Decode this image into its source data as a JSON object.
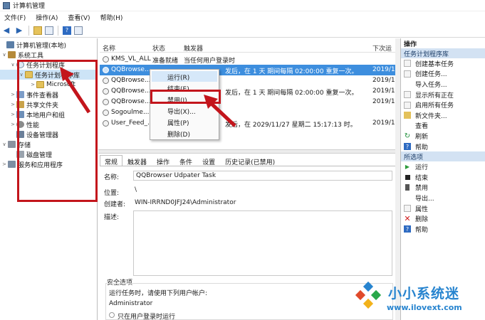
{
  "window": {
    "title": "计算机管理"
  },
  "menu": [
    "文件(F)",
    "操作(A)",
    "查看(V)",
    "帮助(H)"
  ],
  "toolbar": {
    "help_glyph": "?"
  },
  "tree": {
    "items": [
      {
        "label": "计算机管理(本地)",
        "arrow": ""
      },
      {
        "label": "系统工具",
        "arrow": "∨"
      },
      {
        "label": "任务计划程序",
        "arrow": "∨"
      },
      {
        "label": "任务计划程序库",
        "arrow": "∨"
      },
      {
        "label": "Microsoft",
        "arrow": ">"
      },
      {
        "label": "事件查看器",
        "arrow": ">"
      },
      {
        "label": "共享文件夹",
        "arrow": ">"
      },
      {
        "label": "本地用户和组",
        "arrow": ">"
      },
      {
        "label": "性能",
        "arrow": ">"
      },
      {
        "label": "设备管理器",
        "arrow": ""
      },
      {
        "label": "存储",
        "arrow": "∨"
      },
      {
        "label": "磁盘管理",
        "arrow": ""
      },
      {
        "label": "服务和应用程序",
        "arrow": ">"
      }
    ]
  },
  "list": {
    "headers": {
      "name": "名称",
      "status": "状态",
      "trigger": "触发器",
      "next": "下次运"
    },
    "rows": [
      {
        "name": "KMS_VL_ALL",
        "status": "准备就绪",
        "trigger": "当任何用户登录时",
        "next": ""
      },
      {
        "name": "QQBrowse...",
        "status": "",
        "trigger": "发后，在 1 天 期间每隔 02:00:00 重复一次。",
        "next": "2019/11"
      },
      {
        "name": "QQBrowse...",
        "status": "",
        "trigger": "",
        "next": "2019/11"
      },
      {
        "name": "QQBrowse...",
        "status": "",
        "trigger": "发后，在 1 天 期间每隔 02:00:00 重复一次。",
        "next": "2019/11"
      },
      {
        "name": "QQBrowse...",
        "status": "",
        "trigger": "",
        "next": "2019/11"
      },
      {
        "name": "Sogoulme...",
        "status": "",
        "trigger": "",
        "next": ""
      },
      {
        "name": "User_Feed_...",
        "status": "",
        "trigger": "发后，在 2029/11/27 星期二 15:17:13 时。",
        "next": "2019/11"
      }
    ]
  },
  "context_menu": {
    "items": [
      "运行(R)",
      "结束(E)",
      "禁用(I)",
      "导出(X)...",
      "属性(P)",
      "删除(D)"
    ]
  },
  "detail": {
    "tabs": [
      "常规",
      "触发器",
      "操作",
      "条件",
      "设置",
      "历史记录(已禁用)"
    ],
    "name_label": "名称:",
    "name_value": "QQBrowser Udpater Task",
    "location_label": "位置:",
    "location_value": "\\",
    "author_label": "创建者:",
    "author_value": "WIN-IRRND0JFJ24\\Administrator",
    "desc_label": "描述:",
    "security_title": "安全选项",
    "security_run_as": "运行任务时，请使用下列用户帐户:",
    "security_user": "Administrator",
    "security_option": "只在用户登录时运行"
  },
  "actions": {
    "header": "操作",
    "section1": "任务计划程序库",
    "items1": [
      {
        "label": "创建基本任务",
        "icon": "blank"
      },
      {
        "label": "创建任务...",
        "icon": "blank"
      },
      {
        "label": "导入任务...",
        "icon": "none"
      },
      {
        "label": "显示所有正在",
        "icon": "blank"
      },
      {
        "label": "启用所有任务",
        "icon": "blank"
      },
      {
        "label": "新文件夹...",
        "icon": "folder"
      },
      {
        "label": "查看",
        "icon": "none"
      },
      {
        "label": "刷新",
        "icon": "refresh"
      },
      {
        "label": "帮助",
        "icon": "help"
      }
    ],
    "section2": "所选项",
    "items2": [
      {
        "label": "运行",
        "icon": "run"
      },
      {
        "label": "结束",
        "icon": "stop"
      },
      {
        "label": "禁用",
        "icon": "disable"
      },
      {
        "label": "导出...",
        "icon": "none"
      },
      {
        "label": "属性",
        "icon": "blank"
      },
      {
        "label": "删除",
        "icon": "x"
      },
      {
        "label": "帮助",
        "icon": "help"
      }
    ]
  },
  "watermark": {
    "title": "小小系统迷",
    "url": "www.ilovext.com"
  },
  "colors": {
    "annotation_red": "#c3151c",
    "selection_blue": "#3d8ede",
    "watermark_blue": "#2784cf"
  }
}
